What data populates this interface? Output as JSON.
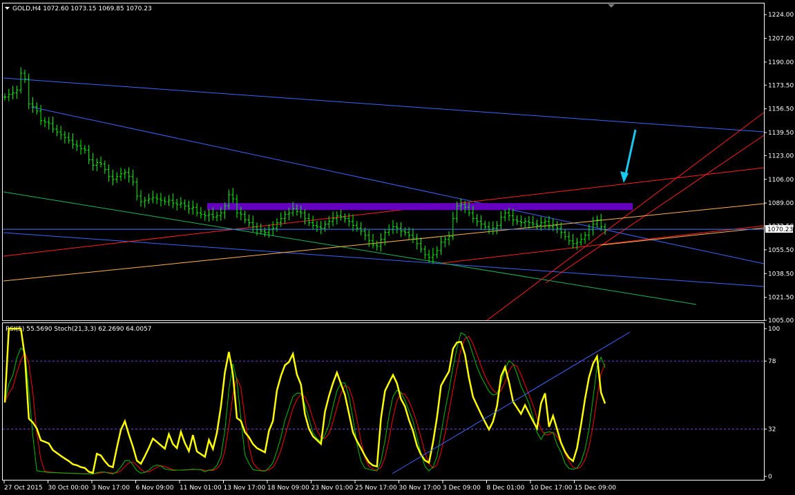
{
  "chart_data": [
    {
      "type": "candlestick",
      "title": "GOLD,H4  1072.60 1073.15 1069.85 1070.23",
      "current_price": "1070.23",
      "ylim": [
        1005,
        1232
      ],
      "price_axis_ticks": [
        "1224.00",
        "1207.00",
        "1190.00",
        "1173.50",
        "1156.50",
        "1139.50",
        "1123.00",
        "1106.00",
        "1089.00",
        "1072.50",
        "1055.50",
        "1038.50",
        "1021.50",
        "1005.00"
      ],
      "time_axis_ticks": [
        "27 Oct 2015",
        "30 Oct 00:00",
        "3 Nov 17:00",
        "6 Nov 09:00",
        "11 Nov 01:00",
        "13 Nov 17:00",
        "18 Nov 09:00",
        "23 Nov 01:00",
        "25 Nov 17:00",
        "30 Nov 17:00",
        "3 Dec 09:00",
        "8 Dec 01:00",
        "10 Dec 17:00",
        "15 Dec 09:00"
      ],
      "closes": [
        1165,
        1167,
        1168,
        1170,
        1182,
        1178,
        1160,
        1158,
        1155,
        1148,
        1147,
        1146,
        1142,
        1140,
        1138,
        1136,
        1134,
        1131,
        1130,
        1128,
        1127,
        1120,
        1116,
        1118,
        1117,
        1113,
        1108,
        1106,
        1108,
        1110,
        1111,
        1108,
        1104,
        1094,
        1090,
        1091,
        1092,
        1093,
        1092,
        1091,
        1090,
        1091,
        1089,
        1088,
        1089,
        1087,
        1085,
        1086,
        1082,
        1081,
        1080,
        1081,
        1079,
        1080,
        1082,
        1087,
        1095,
        1092,
        1082,
        1081,
        1077,
        1075,
        1072,
        1070,
        1069,
        1068,
        1070,
        1071,
        1075,
        1078,
        1081,
        1082,
        1085,
        1083,
        1082,
        1078,
        1075,
        1073,
        1072,
        1071,
        1074,
        1076,
        1078,
        1080,
        1079,
        1078,
        1076,
        1073,
        1071,
        1069,
        1066,
        1062,
        1059,
        1058,
        1063,
        1068,
        1070,
        1072,
        1071,
        1069,
        1068,
        1066,
        1064,
        1060,
        1056,
        1052,
        1050,
        1052,
        1055,
        1061,
        1063,
        1065,
        1078,
        1087,
        1088,
        1086,
        1082,
        1078,
        1076,
        1074,
        1072,
        1070,
        1071,
        1073,
        1079,
        1082,
        1080,
        1077,
        1076,
        1075,
        1076,
        1075,
        1074,
        1073,
        1075,
        1076,
        1072,
        1073,
        1071,
        1068,
        1065,
        1062,
        1060,
        1061,
        1063,
        1066,
        1070,
        1074,
        1077,
        1072,
        1070
      ]
    },
    {
      "type": "line",
      "title": "RSI(5) 55.5690  Stoch(21,3,3) 62.2690 64.0057",
      "ylim": [
        0,
        100
      ],
      "y_ticks": [
        "100",
        "78",
        "32",
        "0"
      ],
      "levels": [
        78,
        32
      ],
      "rsi_period": 5,
      "stoch_period": 21,
      "stoch_smoothing": 3
    }
  ],
  "colors": {
    "background": "#000000",
    "frame": "#ffffff",
    "candle": "#00ff00",
    "rsi": "#ffff00",
    "stoch_main": "#00c000",
    "stoch_signal": "#ff0000",
    "level": "#7a3fd1",
    "resistance_zone": "#6a00c8",
    "arrow": "#19c8f0",
    "trend_blue": "#3c64ff",
    "trend_red": "#ff1e1e",
    "trend_orange": "#ffb44a",
    "trend_green": "#18b85a",
    "price_hline": "#4a7bff"
  },
  "annotations": {
    "resistance_zone": {
      "low": 1084,
      "high": 1089
    },
    "price_hline": 1070.23
  }
}
